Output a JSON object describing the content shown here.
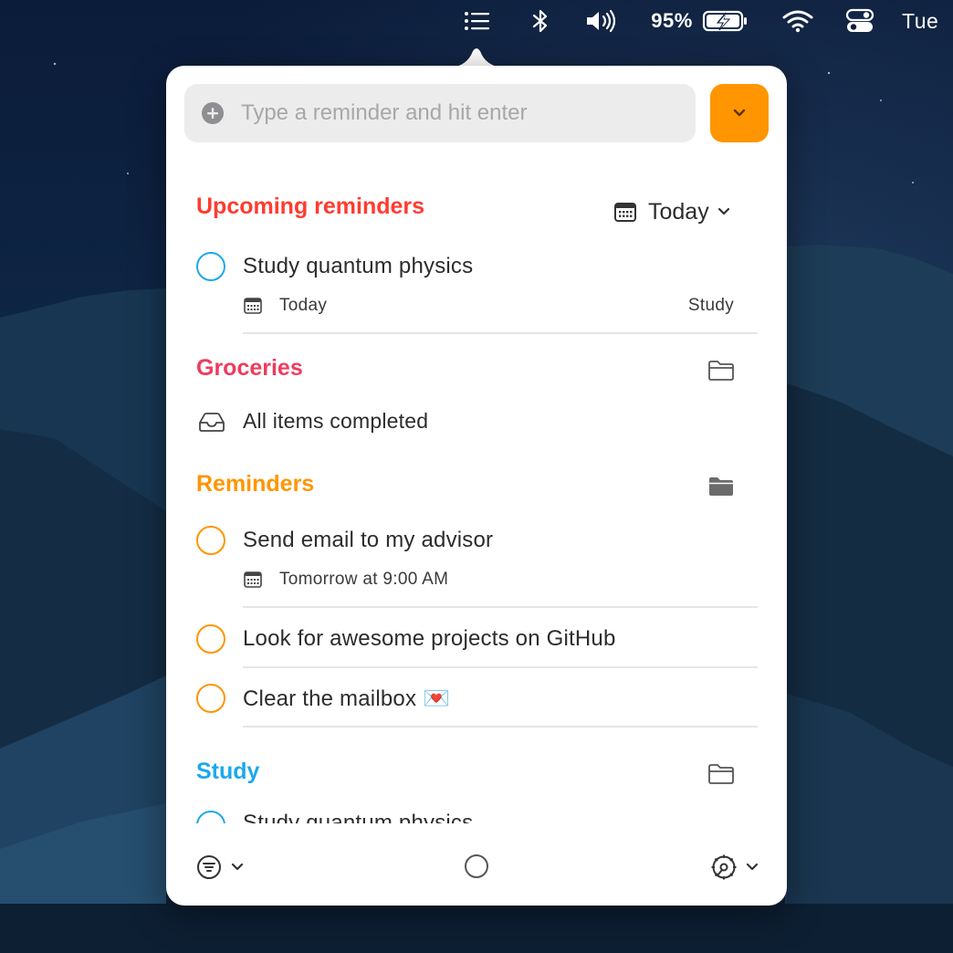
{
  "menubar": {
    "battery_percent": "95%",
    "clock": "Tue"
  },
  "input": {
    "placeholder": "Type a reminder and hit enter",
    "value": ""
  },
  "colors": {
    "accent_orange": "#ff9500",
    "upcoming_red": "#ff3b30",
    "groceries_pink": "#ee3c5e",
    "reminders_orange": "#ff9500",
    "study_blue": "#1ea8ec"
  },
  "upcoming": {
    "title": "Upcoming reminders",
    "filter_label": "Today",
    "items": [
      {
        "title": "Study quantum physics",
        "date": "Today",
        "list": "Study"
      }
    ]
  },
  "groceries": {
    "title": "Groceries",
    "empty_text": "All items completed"
  },
  "reminders": {
    "title": "Reminders",
    "items": [
      {
        "title": "Send email to my advisor",
        "date": "Tomorrow at 9:00 AM"
      },
      {
        "title": "Look for awesome projects on GitHub"
      },
      {
        "title": "Clear the mailbox 💌"
      }
    ]
  },
  "study": {
    "title": "Study",
    "items": [
      {
        "title": "Study quantum physics"
      }
    ]
  },
  "icons": {
    "menubar": [
      "list-icon",
      "bluetooth-icon",
      "volume-icon",
      "battery-charging-icon",
      "wifi-icon",
      "control-center-icon"
    ],
    "footer": [
      "filter-icon",
      "circle-icon",
      "gear-icon"
    ]
  }
}
